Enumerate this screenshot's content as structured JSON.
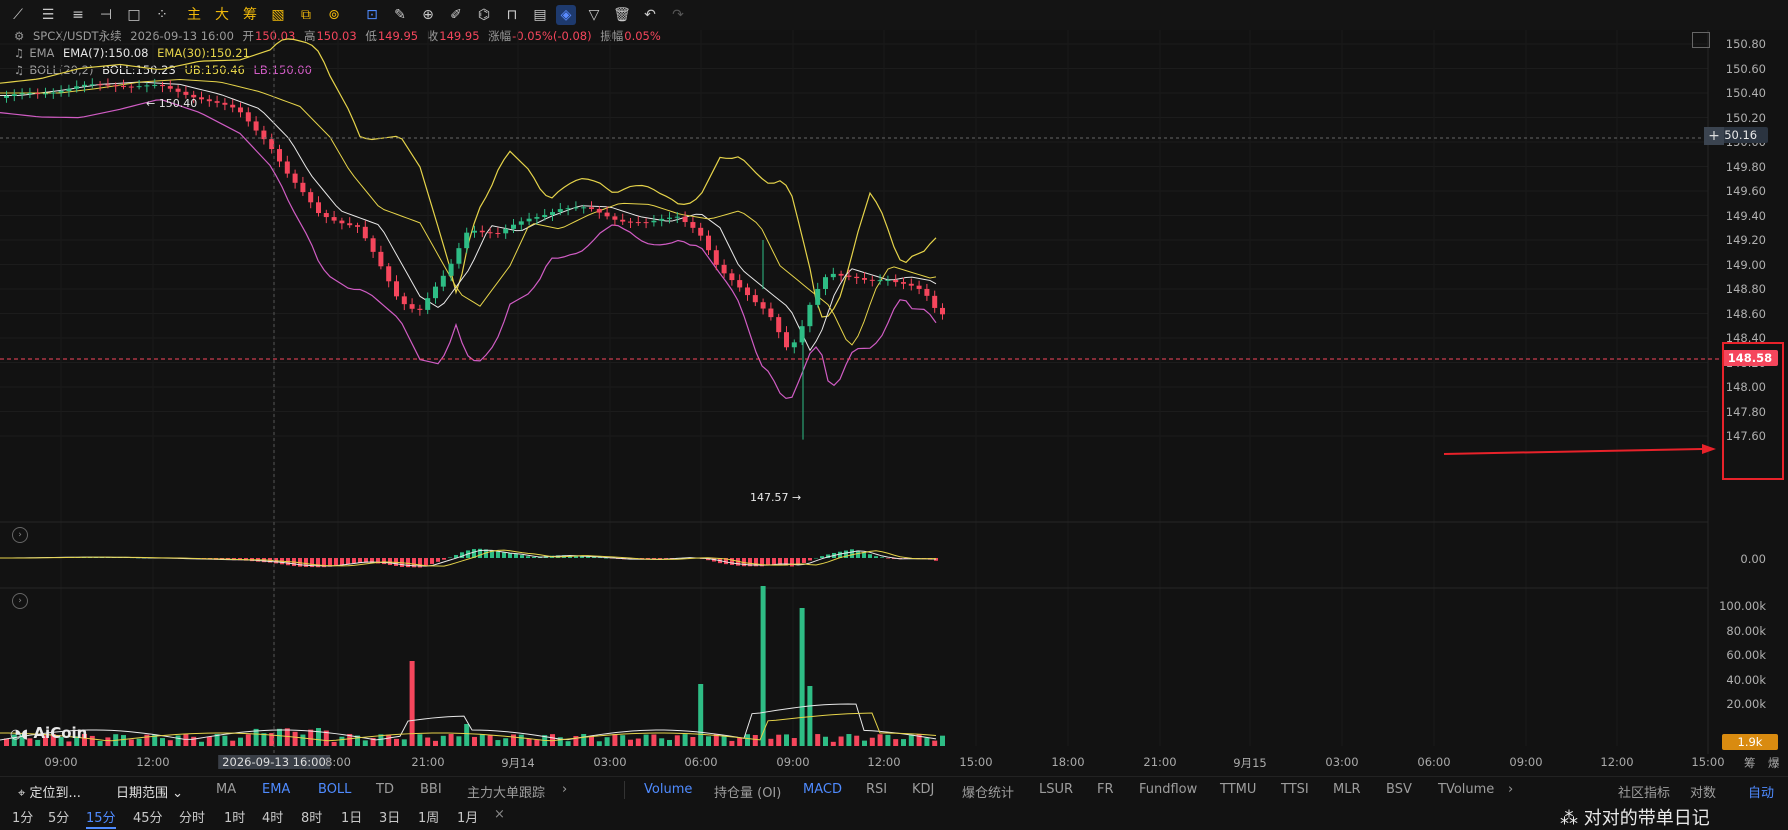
{
  "legend": {
    "symbol": "SPCX/USDT永续",
    "datetime": "2026-09-13 16:00",
    "open_label": "开",
    "open": "150.03",
    "high_label": "高",
    "high": "150.03",
    "low_label": "低",
    "low": "149.95",
    "close_label": "收",
    "close": "149.95",
    "change_label": "涨幅",
    "change": "-0.05%(-0.08)",
    "amp_label": "振幅",
    "amp": "0.05%",
    "ema_name": "EMA",
    "ema7": "EMA(7):150.08",
    "ema30": "EMA(30):150.21",
    "boll_name": "BOLL(20,2)",
    "boll_mid": "BOLL:150.23",
    "boll_ub": "UB:150.46",
    "boll_lb": "LB:150.00"
  },
  "toolbar": {
    "ind_labels": [
      "主",
      "大",
      "筹"
    ]
  },
  "price_axis": [
    "150.80",
    "150.60",
    "150.40",
    "150.20",
    "150.00",
    "149.80",
    "149.60",
    "149.40",
    "149.20",
    "149.00",
    "148.80",
    "148.60",
    "148.40",
    "148.20",
    "148.00",
    "147.80",
    "147.60"
  ],
  "macd_axis": "0.00",
  "vol_axis": [
    "100.00k",
    "80.00k",
    "60.00k",
    "40.00k",
    "20.00k"
  ],
  "crosshair_price": "150.16",
  "last_price": "148.58",
  "vol_tag": "1.9k",
  "annotations": {
    "high": "150.40",
    "low": "147.57"
  },
  "time_axis": [
    "09:00",
    "12:00",
    "2026-09-13 16:00",
    "8:00",
    "21:00",
    "9月14",
    "03:00",
    "06:00",
    "09:00",
    "12:00",
    "15:00",
    "18:00",
    "21:00",
    "9月15",
    "03:00",
    "06:00",
    "09:00",
    "12:00",
    "15:00"
  ],
  "corner": [
    "筹",
    "爆"
  ],
  "logo": "AiCoin",
  "bottom_indicators": {
    "left_btn1": "定位到...",
    "left_btn2": "日期范围",
    "main": [
      "MA",
      "EMA",
      "BOLL",
      "TD",
      "BBI",
      "主力大单跟踪"
    ],
    "sub": [
      "Volume",
      "持仓量 (OI)",
      "MACD",
      "RSI",
      "KDJ",
      "爆仓统计",
      "LSUR",
      "FR",
      "Fundflow",
      "TTMU",
      "TTSI",
      "MLR",
      "BSV",
      "TVolume"
    ],
    "right": [
      "社区指标",
      "对数",
      "自动"
    ]
  },
  "intervals": [
    "1分",
    "5分",
    "15分",
    "45分",
    "分时",
    "1时",
    "4时",
    "8时",
    "1日",
    "3日",
    "1周",
    "1月"
  ],
  "watermark": "对对的带单日记",
  "colors": {
    "up": "#2ebd85",
    "down": "#f5465c",
    "ema7": "#e8e8e8",
    "ema30": "#e5d34a",
    "boll_ub": "#e5d34a",
    "boll_lb": "#d05cc4",
    "accent": "#4f8bff",
    "annot": "#e8222a"
  },
  "chart_data": {
    "type": "candlestick",
    "x_start": "2026-09-13 07:30",
    "interval": "15m",
    "candles": []
  }
}
